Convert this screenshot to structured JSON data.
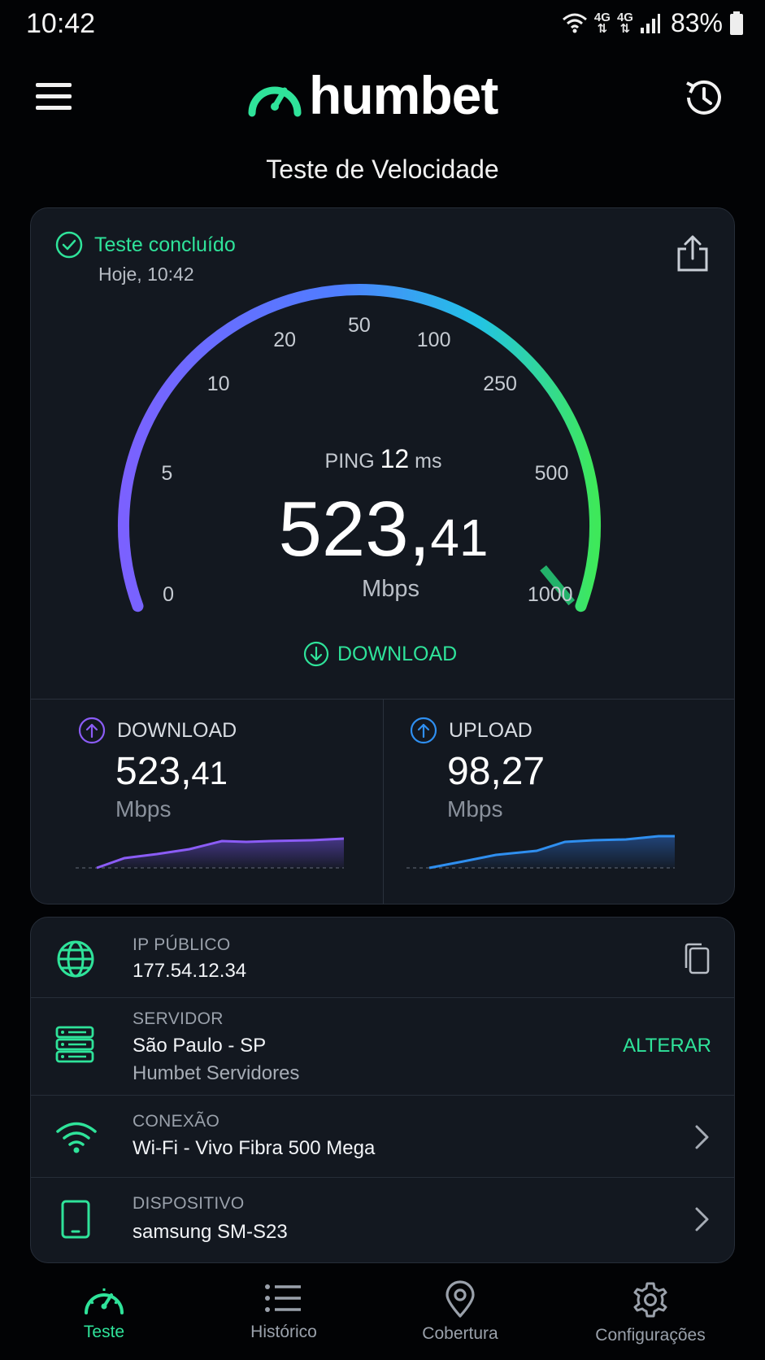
{
  "status_bar": {
    "time": "10:42",
    "net1": "4G",
    "net2": "4G",
    "battery": "83%"
  },
  "header": {
    "logo_text": "humbet",
    "page_title": "Teste de Velocidade"
  },
  "result": {
    "status": "Teste concluído",
    "date": "Hoje, 10:42",
    "ping_label": "PING",
    "ping_value": "12",
    "ping_unit": "ms",
    "speed_int": "523,",
    "speed_dec": "41",
    "speed_unit": "Mbps",
    "mode_label": "DOWNLOAD",
    "gauge_ticks": [
      "0",
      "5",
      "10",
      "20",
      "50",
      "100",
      "250",
      "500",
      "1000"
    ],
    "gauge_needle_value": 523.41
  },
  "metrics": {
    "download": {
      "label": "DOWNLOAD",
      "value_int": "523,",
      "value_dec": "41",
      "unit": "Mbps",
      "color": "#8b5cf6"
    },
    "upload": {
      "label": "UPLOAD",
      "value_int": "98,",
      "value_dec": "27",
      "unit": "Mbps",
      "color": "#2f8ff0"
    }
  },
  "info": {
    "ip": {
      "label": "IP PÚBLICO",
      "value": "177.54.12.34"
    },
    "server": {
      "label": "SERVIDOR",
      "value": "São Paulo - SP",
      "sub": "Humbet Servidores",
      "action": "ALTERAR"
    },
    "connection": {
      "label": "CONEXÃO",
      "value": "Wi-Fi - Vivo Fibra 500 Mega"
    },
    "device": {
      "label": "DISPOSITIVO",
      "value": "samsung SM-S23"
    }
  },
  "nav": [
    {
      "label": "Teste",
      "icon": "speedometer-icon",
      "active": true
    },
    {
      "label": "Histórico",
      "icon": "list-icon",
      "active": false
    },
    {
      "label": "Cobertura",
      "icon": "map-pin-icon",
      "active": false
    },
    {
      "label": "Configurações",
      "icon": "gear-icon",
      "active": false
    }
  ],
  "colors": {
    "accent": "#2fe39a",
    "background": "#020305",
    "card": "#131820"
  }
}
